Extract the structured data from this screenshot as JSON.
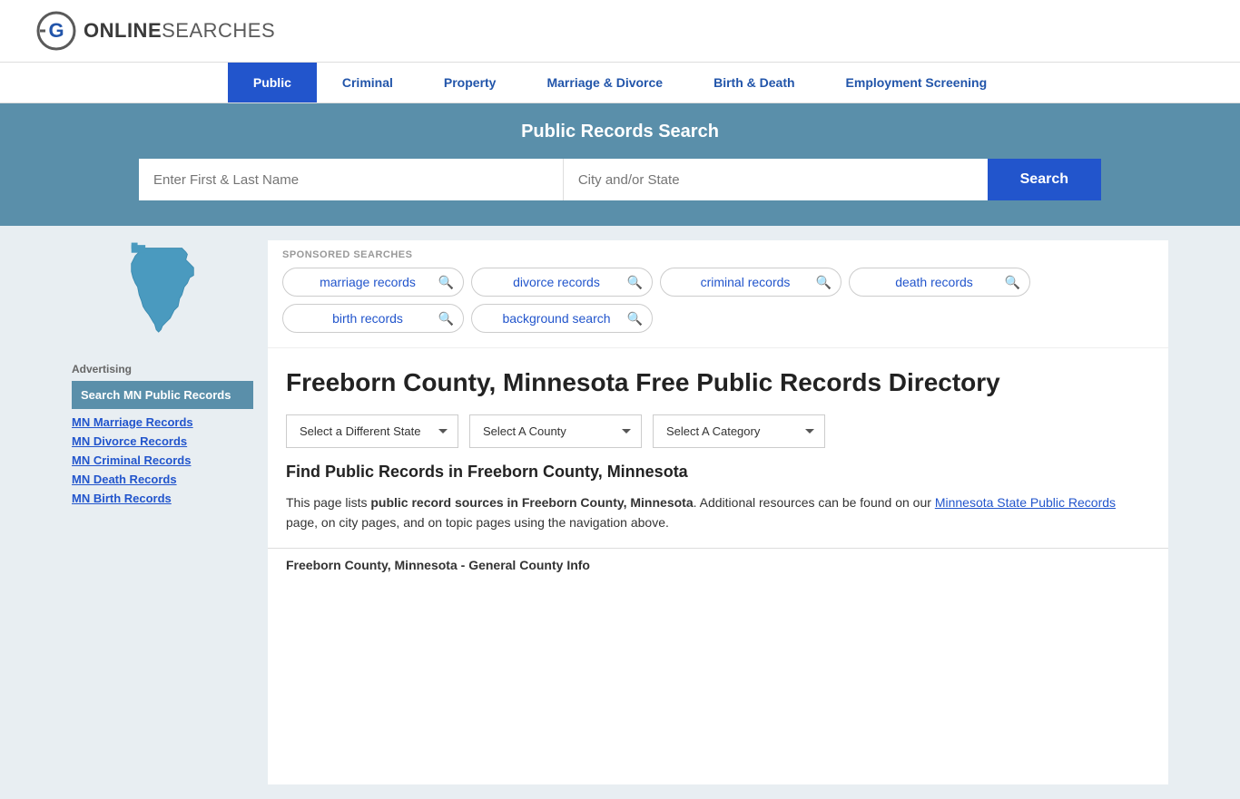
{
  "logo": {
    "text_online": "ONLINE",
    "text_searches": "SEARCHES",
    "icon_label": "OnlineSearches logo"
  },
  "nav": {
    "items": [
      {
        "label": "Public",
        "active": true
      },
      {
        "label": "Criminal",
        "active": false
      },
      {
        "label": "Property",
        "active": false
      },
      {
        "label": "Marriage & Divorce",
        "active": false
      },
      {
        "label": "Birth & Death",
        "active": false
      },
      {
        "label": "Employment Screening",
        "active": false
      }
    ]
  },
  "hero": {
    "title": "Public Records Search",
    "name_placeholder": "Enter First & Last Name",
    "location_placeholder": "City and/or State",
    "search_label": "Search"
  },
  "sponsored": {
    "label": "SPONSORED SEARCHES",
    "pills": [
      {
        "label": "marriage records"
      },
      {
        "label": "divorce records"
      },
      {
        "label": "criminal records"
      },
      {
        "label": "death records"
      },
      {
        "label": "birth records"
      },
      {
        "label": "background search"
      }
    ]
  },
  "page": {
    "title": "Freeborn County, Minnesota Free Public Records Directory",
    "dropdowns": {
      "state": "Select a Different State",
      "county": "Select A County",
      "category": "Select A Category"
    },
    "find_title": "Find Public Records in Freeborn County, Minnesota",
    "find_text_prefix": "This page lists ",
    "find_text_bold": "public record sources in Freeborn County, Minnesota",
    "find_text_suffix": ". Additional resources can be found on our ",
    "find_link_text": "Minnesota State Public Records",
    "find_text_end": " page, on city pages, and on topic pages using the navigation above.",
    "county_info_heading": "Freeborn County, Minnesota - General County Info"
  },
  "sidebar": {
    "advertising_label": "Advertising",
    "active_link": "Search MN Public Records",
    "links": [
      {
        "label": "MN Marriage Records"
      },
      {
        "label": "MN Divorce Records"
      },
      {
        "label": "MN Criminal Records"
      },
      {
        "label": "MN Death Records"
      },
      {
        "label": "MN Birth Records"
      }
    ]
  }
}
